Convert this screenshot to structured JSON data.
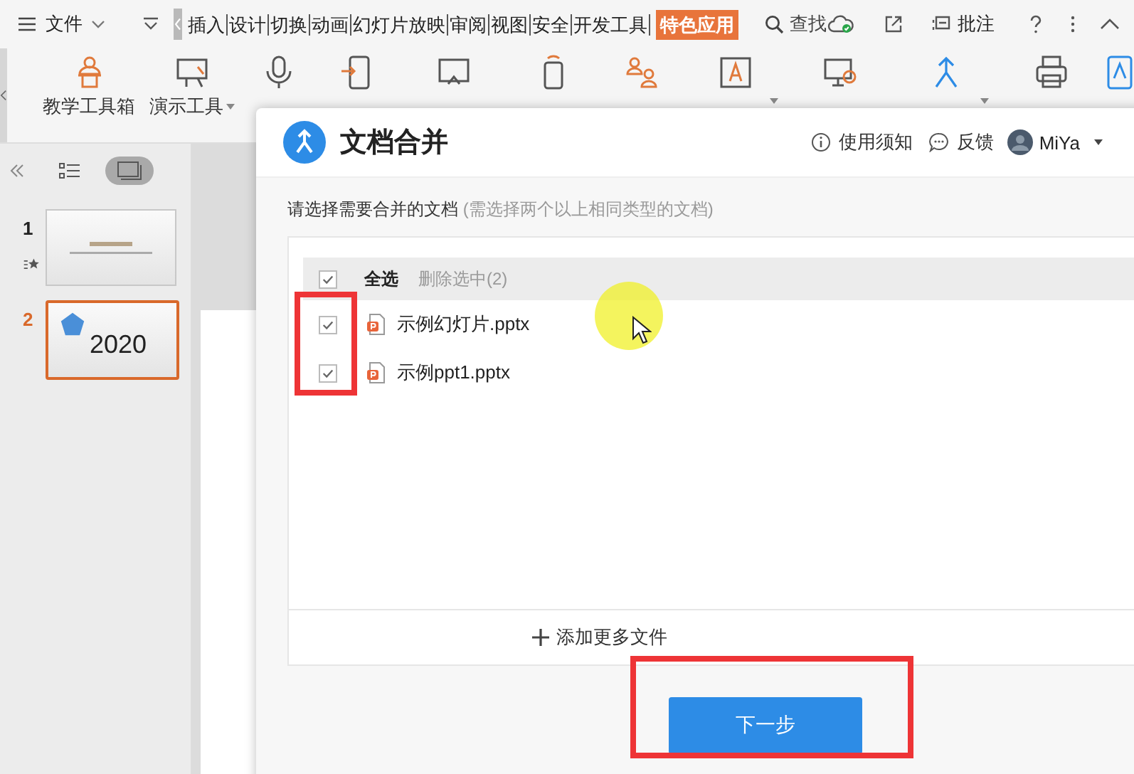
{
  "menubar": {
    "file_menu": "文件",
    "tabs": [
      {
        "label": "插入",
        "selected": false
      },
      {
        "label": "设计",
        "selected": false
      },
      {
        "label": "切换",
        "selected": false
      },
      {
        "label": "动画",
        "selected": false
      },
      {
        "label": "幻灯片放映",
        "selected": false
      },
      {
        "label": "审阅",
        "selected": false
      },
      {
        "label": "视图",
        "selected": false
      },
      {
        "label": "安全",
        "selected": false
      },
      {
        "label": "开发工具",
        "selected": false
      },
      {
        "label": "特色应用",
        "selected": true
      }
    ],
    "search": "查找",
    "comment": "批注"
  },
  "ribbon": {
    "tools": [
      {
        "label": "教学工具箱",
        "dropdown": false
      },
      {
        "label": "演示工具",
        "dropdown": true
      },
      {
        "dropdown": false
      },
      {
        "dropdown": false
      },
      {
        "dropdown": false
      },
      {
        "dropdown": false
      },
      {
        "dropdown": false
      },
      {
        "dropdown": true
      },
      {
        "dropdown": false
      },
      {
        "dropdown": true
      },
      {
        "dropdown": false
      }
    ]
  },
  "slide_panel": {
    "view_buttons": [
      {
        "selected": false
      },
      {
        "selected": true
      }
    ],
    "slides": [
      {
        "number": "1",
        "selected": false,
        "kind": "title"
      },
      {
        "number": "2",
        "selected": true,
        "kind": "text",
        "text": "2020"
      }
    ]
  },
  "dialog": {
    "title": "文档合并",
    "help": "使用须知",
    "feedback": "反馈",
    "user": "MiYa",
    "prompt": "请选择需要合并的文档",
    "prompt_hint": "(需选择两个以上相同类型的文档)",
    "select_all": {
      "label": "全选",
      "checked": true
    },
    "delete_selected": "删除选中(2)",
    "files": [
      {
        "name": "示例幻灯片.pptx",
        "checked": true
      },
      {
        "name": "示例ppt1.pptx",
        "checked": true
      }
    ],
    "add_more": "添加更多文件",
    "next_button": "下一步"
  }
}
